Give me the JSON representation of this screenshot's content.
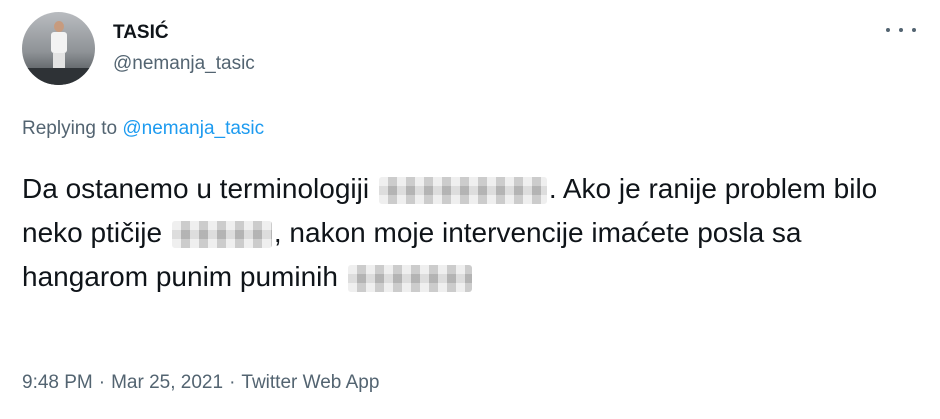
{
  "author": {
    "display_name": "TASIĆ",
    "handle": "@nemanja_tasic"
  },
  "more_icon": "more-horizontal-icon",
  "reply_context": {
    "prefix": "Replying to",
    "mention": "@nemanja_tasic"
  },
  "tweet": {
    "segment_1": "Da ostanemo u terminologiji",
    "segment_2": ". Ako je ranije problem bilo neko ptičije",
    "segment_3": ", nakon moje intervencije imaćete posla sa hangarom punim puminih",
    "redactions": [
      "blurred-word-1",
      "blurred-word-2",
      "blurred-word-3"
    ]
  },
  "meta": {
    "time": "9:48 PM",
    "date": "Mar 25, 2021",
    "source": "Twitter Web App",
    "separator": "·"
  },
  "colors": {
    "text": "#0f1419",
    "secondary": "#536471",
    "link": "#1d9bf0"
  }
}
